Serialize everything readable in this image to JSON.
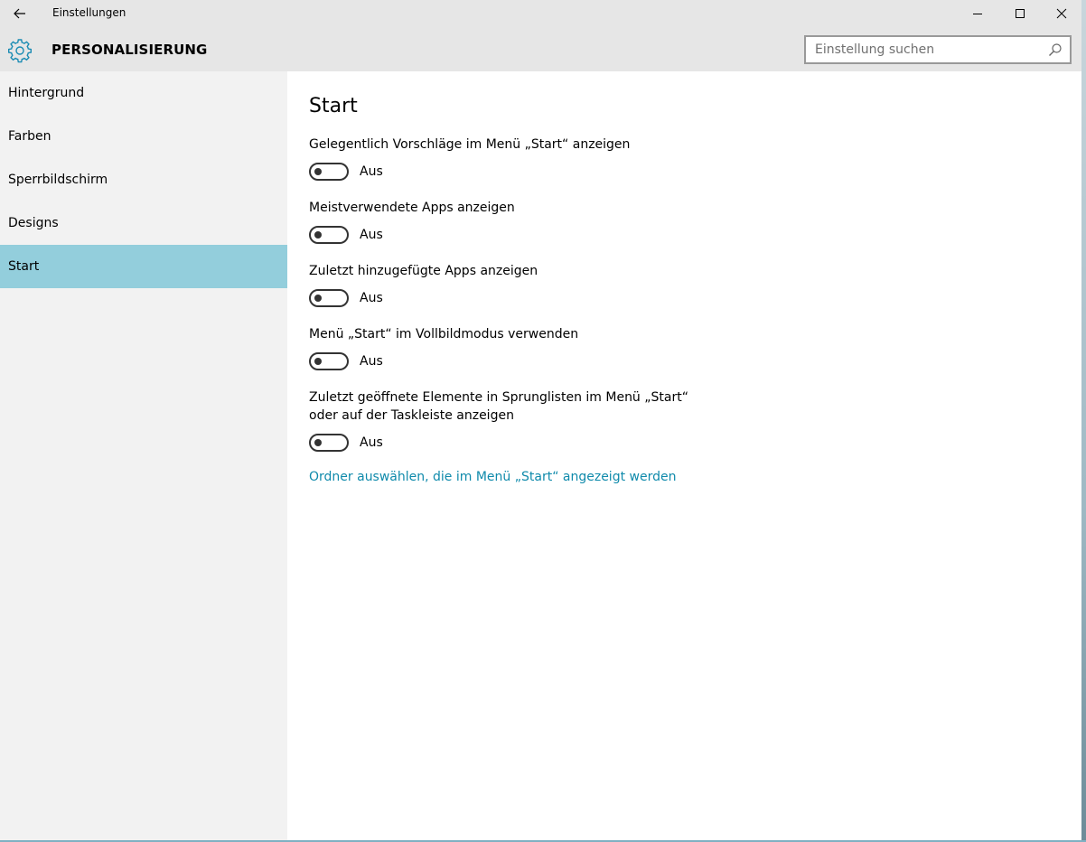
{
  "window": {
    "title": "Einstellungen"
  },
  "header": {
    "section_title": "PERSONALISIERUNG",
    "search_placeholder": "Einstellung suchen"
  },
  "sidebar": {
    "items": [
      {
        "label": "Hintergrund",
        "active": false
      },
      {
        "label": "Farben",
        "active": false
      },
      {
        "label": "Sperrbildschirm",
        "active": false
      },
      {
        "label": "Designs",
        "active": false
      },
      {
        "label": "Start",
        "active": true
      }
    ]
  },
  "main": {
    "heading": "Start",
    "settings": [
      {
        "label": "Gelegentlich Vorschläge im Menü „Start“ anzeigen",
        "state": "Aus",
        "on": false
      },
      {
        "label": "Meistverwendete Apps anzeigen",
        "state": "Aus",
        "on": false
      },
      {
        "label": "Zuletzt hinzugefügte Apps anzeigen",
        "state": "Aus",
        "on": false
      },
      {
        "label": "Menü „Start“ im Vollbildmodus verwenden",
        "state": "Aus",
        "on": false
      },
      {
        "label": "Zuletzt geöffnete Elemente in Sprunglisten im Menü „Start“ oder auf der Taskleiste anzeigen",
        "state": "Aus",
        "on": false
      }
    ],
    "folder_link": "Ordner auswählen, die im Menü „Start“ angezeigt werden"
  },
  "colors": {
    "accent": "#0f8aab",
    "selected_nav": "#93cedc"
  }
}
